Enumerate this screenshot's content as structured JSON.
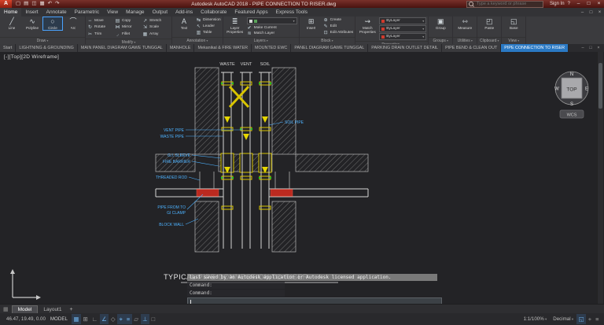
{
  "colors": {
    "titlebar_maroon": "#5a1f18",
    "ribbon_gray": "#3b3b3e",
    "active_tab_blue": "#2a79c4",
    "canvas_bg": "#232326",
    "cad_line": "#d4d4d4",
    "cad_yellow": "#d8c400",
    "cad_red": "#bb2a20",
    "cad_cyan": "#4db2ff",
    "cad_green": "#21c821"
  },
  "app": {
    "logo": "A",
    "title": "Autodesk AutoCAD 2018 - PIPE CONNECTION TO RISER.dwg",
    "search_placeholder": "Type a keyword or phrase",
    "sign_in": "Sign In",
    "help": "?",
    "quick_access": [
      {
        "name": "new",
        "g": "▢"
      },
      {
        "name": "open",
        "g": "▤"
      },
      {
        "name": "save",
        "g": "◫"
      },
      {
        "name": "plot",
        "g": "▦"
      },
      {
        "name": "undo",
        "g": "↶"
      },
      {
        "name": "redo",
        "g": "↷"
      }
    ],
    "window_controls": {
      "min": "–",
      "max": "□",
      "close": "×"
    }
  },
  "ribbon": {
    "tabs": [
      {
        "label": "Home",
        "active": true
      },
      {
        "label": "Insert"
      },
      {
        "label": "Annotate"
      },
      {
        "label": "Parametric"
      },
      {
        "label": "View"
      },
      {
        "label": "Manage"
      },
      {
        "label": "Output"
      },
      {
        "label": "Add-ins"
      },
      {
        "label": "Collaborate"
      },
      {
        "label": "Featured Apps"
      },
      {
        "label": "Express Tools"
      }
    ],
    "doc_controls": {
      "min": "–",
      "max": "□",
      "close": "×"
    },
    "panels": {
      "draw": {
        "label": "Draw",
        "buttons": [
          {
            "label": "Line",
            "g": "╱"
          },
          {
            "label": "Polyline",
            "g": "∿"
          },
          {
            "label": "Circle",
            "g": "○",
            "active": true
          },
          {
            "label": "Arc",
            "g": "⌒"
          }
        ]
      },
      "modify": {
        "label": "Modify",
        "buttons": [
          {
            "label": "Move",
            "g": "↔"
          },
          {
            "label": "Copy",
            "g": "▤"
          },
          {
            "label": "Stretch",
            "g": "↗"
          },
          {
            "label": "Rotate",
            "g": "↻"
          },
          {
            "label": "Mirror",
            "g": "⋈"
          },
          {
            "label": "Scale",
            "g": "⇲"
          },
          {
            "label": "Trim",
            "g": "✂"
          },
          {
            "label": "Fillet",
            "g": "◞"
          },
          {
            "label": "Array",
            "g": "▦"
          }
        ]
      },
      "annotation": {
        "label": "Annotation",
        "big": {
          "label": "Text",
          "g": "A"
        },
        "small": [
          {
            "label": "Dimension",
            "g": "↹"
          },
          {
            "label": "Leader",
            "g": "↖"
          },
          {
            "label": "Table",
            "g": "▥"
          }
        ]
      },
      "layers": {
        "label": "Layers",
        "big": {
          "label": "Layer Properties",
          "g": "≣"
        },
        "small": [
          {
            "label": "Make Current",
            "g": "✔"
          },
          {
            "label": "Match Layer",
            "g": "≋"
          }
        ]
      },
      "block": {
        "label": "Block",
        "big": {
          "label": "Insert",
          "g": "⊞"
        },
        "small": [
          {
            "label": "Create",
            "g": "⊕"
          },
          {
            "label": "Edit",
            "g": "✎"
          },
          {
            "label": "Edit Attributes",
            "g": "⊡"
          }
        ]
      },
      "properties": {
        "label": "Properties",
        "big": {
          "label": "Match Properties",
          "g": "⇝"
        },
        "combos": [
          "ByLayer",
          "ByLayer",
          "ByLayer"
        ]
      },
      "groups": {
        "label": "Groups",
        "big": {
          "label": "Group",
          "g": "▣"
        }
      },
      "utilities": {
        "label": "Utilities",
        "big": {
          "label": "Measure",
          "g": "⇿"
        }
      },
      "clipboard": {
        "label": "Clipboard",
        "big": {
          "label": "Paste",
          "g": "◰"
        }
      },
      "view": {
        "label": "View",
        "big": {
          "label": "Base",
          "g": "◱"
        }
      }
    }
  },
  "file_tabs": {
    "items": [
      {
        "label": "Start"
      },
      {
        "label": "LIGHTNING & GROUNDING"
      },
      {
        "label": "MAIN PANEL DIAGRAM GAWE TUNGGAL"
      },
      {
        "label": "MANHOLE"
      },
      {
        "label": "Mekanikal & FIRE WATER"
      },
      {
        "label": "MOUNTED EWC"
      },
      {
        "label": "PANEL DIAGRAM GAWE TUNGGAL"
      },
      {
        "label": "PARKING DRAIN OUTLET DETAIL"
      },
      {
        "label": "PIPE BEND & CLEAN OUT"
      },
      {
        "label": "PIPE CONNECTION TO RISER",
        "active": true
      }
    ],
    "controls": {
      "min": "–",
      "max": "□",
      "close": "×"
    }
  },
  "canvas": {
    "viewport_label": "[-][Top][2D Wireframe]",
    "viewcube": {
      "n": "N",
      "s": "S",
      "w": "W",
      "e": "E",
      "face": "TOP",
      "ucs": "WCS"
    },
    "drawing": {
      "top_labels": {
        "waste": "WASTE",
        "vent": "VENT",
        "soil": "SOIL"
      },
      "left_labels": {
        "vent_pipe": "VENT PIPE",
        "waste_pipe": "WASTE PIPE",
        "gi_sleeve": "G.I. SLEEVE",
        "fire_barrier": "FIRE BARRIER",
        "threaded_rod": "THREADED ROD",
        "pipe_from": "PIPE FROM TO",
        "gi_clamp": "GI CLAMP",
        "block_wall": "BLOCK WALL"
      },
      "right_labels": {
        "soil_pipe": "SOIL PIPE"
      },
      "title": "TYPICAL PIPE CONNECTION TO RISER"
    }
  },
  "command": {
    "notice": "last saved by an Autodesk application or Autodesk licensed application.",
    "lines": [
      "Command:",
      "Command:"
    ]
  },
  "model_bar": {
    "tabs": [
      {
        "label": "Model",
        "active": true
      },
      {
        "label": "Layout1"
      }
    ],
    "add": "+"
  },
  "status": {
    "coords": "46.47, 19.49, 0.00",
    "model": "MODEL",
    "left_icons": [
      {
        "g": "▦",
        "active": true
      },
      {
        "g": "⊞"
      },
      {
        "g": "∟"
      },
      {
        "g": "∠",
        "active": true
      },
      {
        "g": "◇"
      },
      {
        "g": "⌖",
        "active": true
      },
      {
        "g": "≡",
        "active": true
      },
      {
        "g": "▱"
      },
      {
        "g": "⊥",
        "active": true
      },
      {
        "g": "□"
      }
    ],
    "scale": "1:1/100%",
    "units": "Decimal",
    "right_icons": [
      {
        "g": "◱",
        "active": true
      },
      {
        "g": "+"
      },
      {
        "g": "≡"
      }
    ]
  }
}
